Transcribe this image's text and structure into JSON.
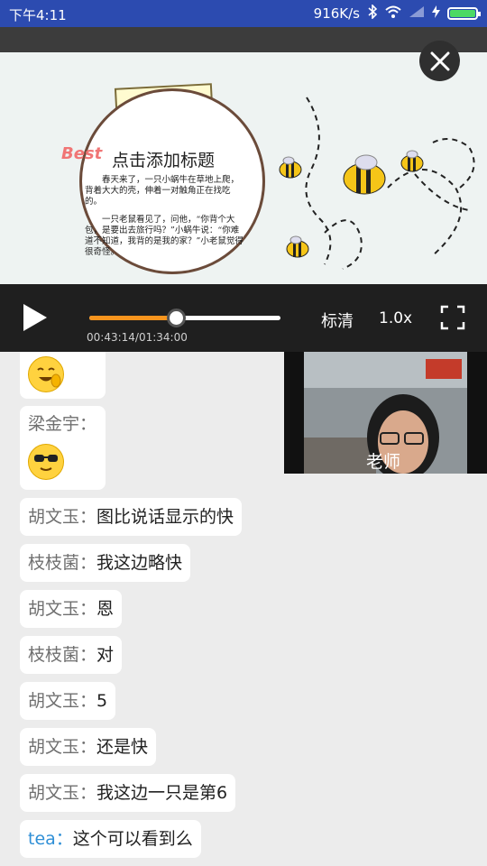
{
  "status_bar": {
    "time": "下午4:11",
    "network_speed": "916K/s",
    "battery_color": "#4cd964"
  },
  "slide": {
    "badge": "Best",
    "title": "点击添加标题",
    "paragraph1": "春天来了，一只小蜗牛在草地上爬，背着大大的壳，伸着一对触角正在找吃的。",
    "paragraph2": "一只老鼠看见了，问他，“你背个大包，是要出去旅行吗？”小蜗牛说：“你难道不知道，我背的是我的家？”小老鼠觉得很奇怪。"
  },
  "player": {
    "progress_fraction": 0.4527,
    "time_display": "00:43:14/01:34:00",
    "quality_label": "标清",
    "speed_label": "1.0x",
    "accent_color": "#f7941d"
  },
  "teacher_cam": {
    "label": "老师"
  },
  "chat": {
    "messages": [
      {
        "sender": "",
        "text": "",
        "emoji": "grinning-hand-emoji"
      },
      {
        "sender": "梁金宇：",
        "text": "",
        "emoji": "sunglasses-emoji"
      },
      {
        "sender": "胡文玉：",
        "text": "图比说话显示的快"
      },
      {
        "sender": "枝枝菌：",
        "text": "我这边略快"
      },
      {
        "sender": "胡文玉：",
        "text": "恩"
      },
      {
        "sender": "枝枝菌：",
        "text": "对"
      },
      {
        "sender": "胡文玉：",
        "text": "5"
      },
      {
        "sender": "胡文玉：",
        "text": "还是快"
      },
      {
        "sender": "胡文玉：",
        "text": "我这边一只是第6"
      },
      {
        "sender": "tea：",
        "text": "这个可以看到么"
      }
    ]
  }
}
